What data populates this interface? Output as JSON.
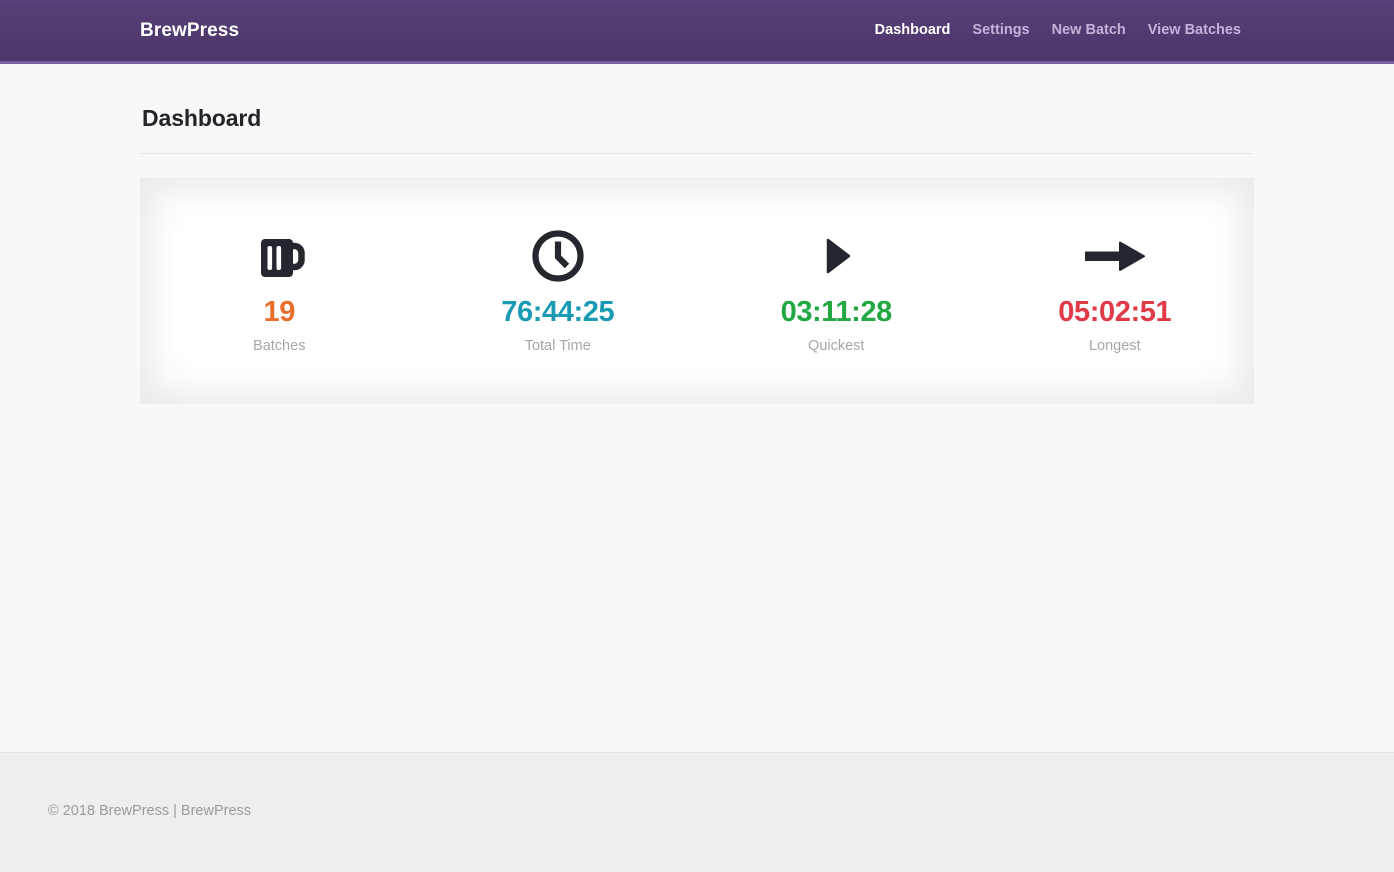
{
  "navbar": {
    "brand": "BrewPress",
    "links": [
      {
        "label": "Dashboard",
        "active": true
      },
      {
        "label": "Settings",
        "active": false
      },
      {
        "label": "New Batch",
        "active": false
      },
      {
        "label": "View Batches",
        "active": false
      }
    ]
  },
  "main": {
    "page_title": "Dashboard",
    "stats": [
      {
        "icon": "beer-mug-icon",
        "value": "19",
        "label": "Batches",
        "color": "#e8702a"
      },
      {
        "icon": "clock-icon",
        "value": "76:44:25",
        "label": "Total Time",
        "color": "#1b9bb3"
      },
      {
        "icon": "play-triangle-icon",
        "value": "03:11:28",
        "label": "Quickest",
        "color": "#22a843"
      },
      {
        "icon": "arrow-right-icon",
        "value": "05:02:51",
        "label": "Longest",
        "color": "#e03a48"
      }
    ]
  },
  "footer": {
    "text": "© 2018 BrewPress | BrewPress"
  },
  "colors": {
    "navbar_purple": "#513a6f",
    "navbar_border": "#7a5fa0",
    "page_background": "#f8f8f8",
    "footer_background": "#eeeeee",
    "icon_dark": "#24282e",
    "label_gray": "#a6a6a6"
  }
}
